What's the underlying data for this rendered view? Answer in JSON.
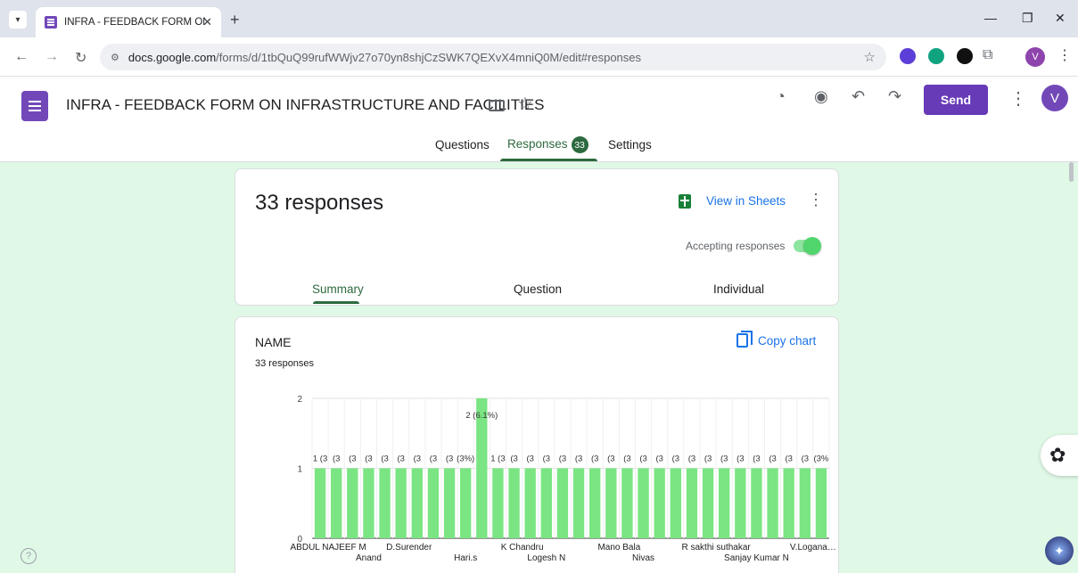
{
  "browser": {
    "tab_title": "INFRA - FEEDBACK FORM ON INFRASTRUCTURE AND FACILITIES",
    "url_host": "docs.google.com",
    "url_path": "/forms/d/1tbQuQ99rufWWjv27o70yn8shjCzSWK7QEXvX4mniQ0M/edit#responses",
    "profile_initial": "V"
  },
  "header": {
    "title": "INFRA - FEEDBACK FORM ON INFRASTRUCTURE AND FACILITIES",
    "send_label": "Send",
    "avatar_initial": "V"
  },
  "nav": {
    "questions": "Questions",
    "responses": "Responses",
    "responses_count": "33",
    "settings": "Settings"
  },
  "summary": {
    "count_text": "33 responses",
    "view_in_sheets": "View in Sheets",
    "accepting_label": "Accepting responses",
    "accepting": true,
    "tabs": [
      "Summary",
      "Question",
      "Individual"
    ]
  },
  "question": {
    "title": "NAME",
    "subtitle": "33 responses",
    "copy_chart": "Copy chart"
  },
  "chart_data": {
    "type": "bar",
    "color": "#7ae582",
    "ylim": [
      0,
      2
    ],
    "yticks": [
      0,
      1,
      2
    ],
    "values": [
      1,
      1,
      1,
      1,
      1,
      1,
      1,
      1,
      1,
      1,
      2,
      1,
      1,
      1,
      1,
      1,
      1,
      1,
      1,
      1,
      1,
      1,
      1,
      1,
      1,
      1,
      1,
      1,
      1,
      1,
      1,
      1
    ],
    "bar_labels": [
      "1 (3",
      "(3",
      "(3",
      "(3",
      "(3",
      "(3",
      "(3",
      "(3",
      "(3",
      "(3%)",
      "2 (6.1%)",
      "1 (3",
      "(3",
      "(3",
      "(3",
      "(3",
      "(3",
      "(3",
      "(3",
      "(3",
      "(3",
      "(3",
      "(3",
      "(3",
      "(3",
      "(3",
      "(3",
      "(3",
      "(3",
      "(3",
      "(3",
      "(3%"
    ],
    "x_tick_labels": [
      {
        "index": 0,
        "text": "ABDUL NAJEEF M",
        "row": 0
      },
      {
        "index": 3,
        "text": "Anand",
        "row": 1
      },
      {
        "index": 5,
        "text": "D.Surender",
        "row": 0
      },
      {
        "index": 9,
        "text": "Hari.s",
        "row": 1
      },
      {
        "index": 12,
        "text": "K Chandru",
        "row": 0
      },
      {
        "index": 14,
        "text": "Logesh N",
        "row": 1
      },
      {
        "index": 18,
        "text": "Mano Bala",
        "row": 0
      },
      {
        "index": 20,
        "text": "Nivas",
        "row": 1
      },
      {
        "index": 24,
        "text": "R sakthi suthakar",
        "row": 0
      },
      {
        "index": 27,
        "text": "Sanjay Kumar N",
        "row": 1
      },
      {
        "index": 30,
        "text": "V.Logana…",
        "row": 0
      }
    ]
  }
}
